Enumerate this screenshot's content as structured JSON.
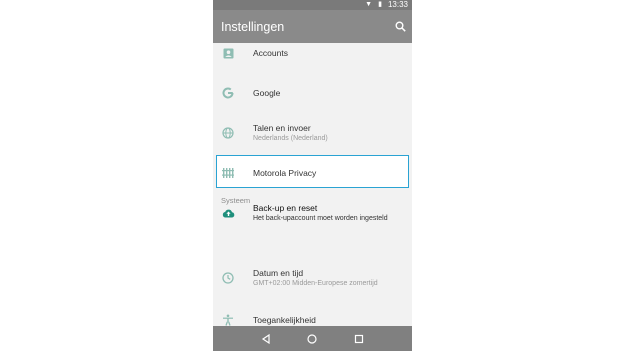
{
  "status_bar": {
    "time": "13:33",
    "icons": [
      "wifi-icon",
      "battery-icon"
    ]
  },
  "app_bar": {
    "title": "Instellingen",
    "search_icon": "search-icon"
  },
  "items": [
    {
      "primary": "Accounts",
      "secondary": "",
      "icon": "account-icon"
    },
    {
      "primary": "Google",
      "secondary": "",
      "icon": "google-icon"
    },
    {
      "primary": "Talen en invoer",
      "secondary": "Nederlands (Nederland)",
      "icon": "globe-icon"
    },
    {
      "primary": "Motorola Privacy",
      "secondary": "",
      "icon": "privacy-icon"
    },
    {
      "primary": "Back-up en reset",
      "secondary": "Het back-upaccount moet worden ingesteld",
      "icon": "cloud-upload-icon"
    },
    {
      "primary": "Datum en tijd",
      "secondary": "GMT+02:00 Midden-Europese zomertijd",
      "icon": "clock-icon"
    },
    {
      "primary": "Toegankelijkheid",
      "secondary": "",
      "icon": "accessibility-icon"
    }
  ],
  "section_header": "Systeem",
  "nav_bar": {
    "icons": [
      "back-icon",
      "home-icon",
      "recents-icon"
    ]
  },
  "colors": {
    "app_bar": "#8a8a8a",
    "accent": "#2aa3d3",
    "icon_tint": "#8fbdb3",
    "highlight_icon": "#1f8f7c"
  }
}
